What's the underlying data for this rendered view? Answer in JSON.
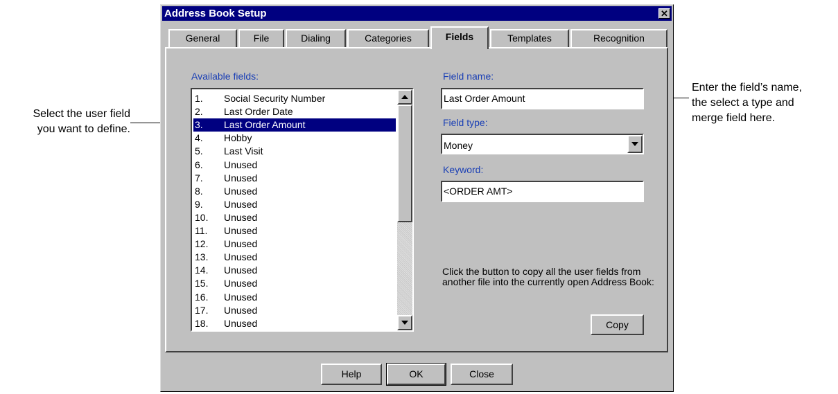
{
  "window": {
    "title": "Address Book Setup",
    "close_glyph": "✕"
  },
  "tabs": [
    {
      "label": "General",
      "active": false
    },
    {
      "label": "File",
      "active": false
    },
    {
      "label": "Dialing",
      "active": false
    },
    {
      "label": "Categories",
      "active": false
    },
    {
      "label": "Fields",
      "active": true
    },
    {
      "label": "Templates",
      "active": false
    },
    {
      "label": "Recognition",
      "active": false
    }
  ],
  "available_fields": {
    "label": "Available fields:",
    "selected_index": 2,
    "items": [
      {
        "num": "1.",
        "name": "Social Security Number"
      },
      {
        "num": "2.",
        "name": "Last Order Date"
      },
      {
        "num": "3.",
        "name": "Last Order Amount"
      },
      {
        "num": "4.",
        "name": "Hobby"
      },
      {
        "num": "5.",
        "name": "Last Visit"
      },
      {
        "num": "6.",
        "name": "Unused"
      },
      {
        "num": "7.",
        "name": "Unused"
      },
      {
        "num": "8.",
        "name": "Unused"
      },
      {
        "num": "9.",
        "name": "Unused"
      },
      {
        "num": "10.",
        "name": "Unused"
      },
      {
        "num": "11.",
        "name": "Unused"
      },
      {
        "num": "12.",
        "name": "Unused"
      },
      {
        "num": "13.",
        "name": "Unused"
      },
      {
        "num": "14.",
        "name": "Unused"
      },
      {
        "num": "15.",
        "name": "Unused"
      },
      {
        "num": "16.",
        "name": "Unused"
      },
      {
        "num": "17.",
        "name": "Unused"
      },
      {
        "num": "18.",
        "name": "Unused"
      }
    ]
  },
  "field_name": {
    "label": "Field name:",
    "value": "Last Order Amount"
  },
  "field_type": {
    "label": "Field type:",
    "value": "Money"
  },
  "keyword": {
    "label": "Keyword:",
    "value": "<ORDER AMT>"
  },
  "copy_section": {
    "description": "Click the button to copy all the user fields from another file into the currently open Address Book:",
    "button": "Copy"
  },
  "footer": {
    "help": "Help",
    "ok": "OK",
    "close": "Close"
  },
  "callouts": {
    "left_line1": "Select the user field",
    "left_line2": "you want to define.",
    "right_line1": "Enter the field’s name,",
    "right_line2": "the select a type and",
    "right_line3": "merge field here."
  },
  "colors": {
    "titlebar": "#000080",
    "dialog_face": "#c0c0c0",
    "selection": "#000080",
    "label_blue": "#1a3fb5"
  }
}
